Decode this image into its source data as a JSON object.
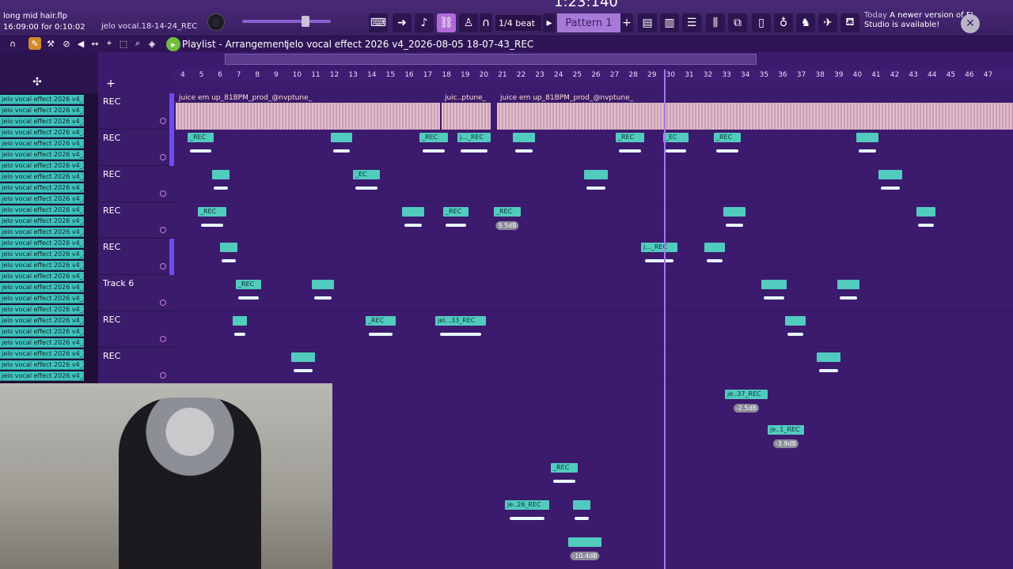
{
  "topbar": {
    "song_title": "long mid hair.flp",
    "song_time": "16:09:00 for 0:10:02",
    "rec_file": "jelo vocal.18-14-24_REC",
    "time_display": "1:23:140",
    "snap": "1/4 beat",
    "pattern": "Pattern 1",
    "news_today": "Today",
    "news_message": "A newer version of FL Studio is available!"
  },
  "playlist": {
    "window_name": "Playlist - Arrangement",
    "file_name": "jelo vocal effect 2026 v4_2026-08-05 18-07-43_REC"
  },
  "picker": {
    "item_label": "jelo vocal effect 2026 v4_2"
  },
  "ruler": {
    "bars": [
      "4",
      "5",
      "6",
      "7",
      "8",
      "9",
      "10",
      "11",
      "12",
      "13",
      "14",
      "15",
      "16",
      "17",
      "18",
      "19",
      "20",
      "21",
      "22",
      "23",
      "24",
      "25",
      "26",
      "27",
      "28",
      "29",
      "30",
      "31",
      "32",
      "33",
      "34",
      "35",
      "36",
      "37",
      "38",
      "39",
      "40",
      "41",
      "42",
      "43",
      "44",
      "45",
      "46",
      "47"
    ]
  },
  "tracks": [
    {
      "name": "REC"
    },
    {
      "name": "REC"
    },
    {
      "name": "REC"
    },
    {
      "name": "REC"
    },
    {
      "name": "REC"
    },
    {
      "name": "Track 6"
    },
    {
      "name": "REC"
    },
    {
      "name": "REC"
    }
  ],
  "audio_clips": [
    {
      "label": "juice em up_81BPM_prod_@nvptune_"
    },
    {
      "label": "juic..ptune_"
    },
    {
      "label": "juice em up_81BPM_prod_@nvptune_"
    }
  ],
  "clips": [
    {
      "label": "_REC"
    },
    {
      "label": "_REC"
    },
    {
      "label": "_REC"
    },
    {
      "label": "_REC"
    },
    {
      "label": "j..._REC"
    },
    {
      "label": "_REC"
    },
    {
      "label": "_REC"
    },
    {
      "label": "j..._REC"
    },
    {
      "label": "_EC"
    },
    {
      "label": "_REC"
    },
    {
      "label": "_EC"
    },
    {
      "label": "_REC"
    },
    {
      "label": "jel...33_REC"
    },
    {
      "label": "je..37_REC"
    },
    {
      "label": "je..1_REC"
    },
    {
      "label": "je..26_REC"
    },
    {
      "label": "_REC"
    },
    {
      "label": "_REC"
    }
  ],
  "gain": {
    "g1": "9.5dB",
    "g2": "-2.5dB",
    "g3": "-3.9dB",
    "g4": "-10.4dB"
  },
  "colors": {
    "background": "#3c1a6e",
    "clip": "#52cbbf",
    "accent": "#a777f0"
  }
}
